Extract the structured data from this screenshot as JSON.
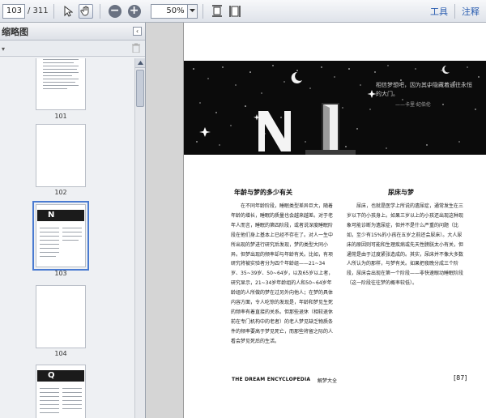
{
  "toolbar": {
    "page_current": "103",
    "page_total": "/ 311",
    "zoom": "50%",
    "tools_label": "工具",
    "comment_label": "注释",
    "icons": [
      "select-icon",
      "hand-icon",
      "zoom-out-icon",
      "zoom-in-icon",
      "fit-page-icon",
      "fit-width-icon"
    ]
  },
  "panel": {
    "title": "缩略图",
    "collapse": "‹",
    "thumbnails": [
      {
        "label": "101",
        "kind": "text"
      },
      {
        "label": "102",
        "kind": "blank"
      },
      {
        "label": "103",
        "kind": "banner",
        "letter": "N",
        "selected": true
      },
      {
        "label": "104",
        "kind": "blank"
      },
      {
        "label": "",
        "kind": "banner",
        "letter": "Q"
      }
    ]
  },
  "document": {
    "quote": "相信梦想吧，因为其中隐藏着通往永恒的大门。",
    "quote_source": "——卡里·纪伯伦",
    "left_column": {
      "title": "年龄与梦的多少有关",
      "text": "在不同年龄阶段，睡眠类型差异巨大，随着年龄的增长，睡眠的质量也会越来越差。对于老年人而言，睡眠的第四阶段，或者说深度睡眠阶段在他们身上基本上已经不存在了。对人一生中所出现的梦进行研究后发现，梦的类型大同小异。但梦出现的频率却与年龄有关。比如，有项研究将被实验者分为四个年龄组——21~34岁、35~39岁、50~64岁，以及65岁以上者，研究显示，21~34岁年龄组的人和50~64岁年龄组的人所做的梦在过另外向他人；在梦的具体内容方面，令人吃惊的发现是，年龄和梦见生死的频率有着直接的关系。但那些退休（相较退休前在专门机构中的老者）的老人梦见缺乏物质条件的频率要高于梦见死亡，而那些将留之际的人看会梦见死后的生活。"
    },
    "right_column": {
      "title": "尿床与梦",
      "text": "尿床，也就是医学上所说的遗尿症，通常发生在三岁以下的小孩身上。如果三岁以上的小孩还出现这种现象可能诊断为遗尿症，但并不是什么严重的问题（比如，至少有15%的小孩在五岁之前还会尿床）。大人尿床的原因则可能和生理疾病或先天性膀胱太小有关，但通常是由于过度紧张造成的。其实，尿床并不像大多数人所认为的那样，与梦有关。如果把夜晚分成三个阶段，尿床会出现在第一个阶段——非快速眼动睡眠阶段（这一阶段往往梦的概率较低）。"
    },
    "footer": {
      "brand": "THE DREAM ENCYCLOPEDIA",
      "subtitle": "解梦大全",
      "page_number": "[87]"
    }
  },
  "colors": {
    "accent": "#4a7bd1",
    "link": "#2a5db0",
    "banner": "#0b0b0b"
  }
}
